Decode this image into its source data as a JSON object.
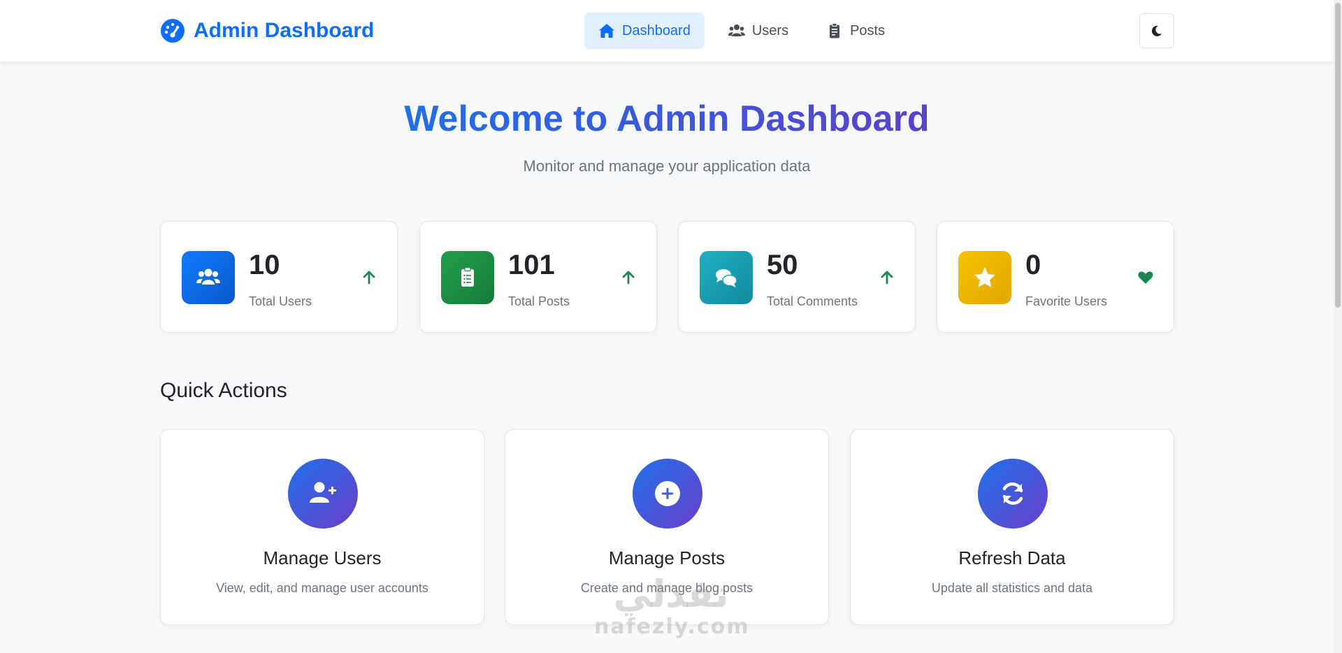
{
  "navbar": {
    "brand": "Admin Dashboard",
    "links": [
      {
        "label": "Dashboard",
        "icon": "home-icon",
        "active": true
      },
      {
        "label": "Users",
        "icon": "users-icon",
        "active": false
      },
      {
        "label": "Posts",
        "icon": "clipboard-icon",
        "active": false
      }
    ],
    "theme_toggle_icon": "moon-icon"
  },
  "hero": {
    "title": "Welcome to Admin Dashboard",
    "subtitle": "Monitor and manage your application data"
  },
  "stats": [
    {
      "value": "10",
      "label": "Total Users",
      "icon": "users-icon",
      "trend_icon": "arrow-up-icon",
      "color": "#0d6efd"
    },
    {
      "value": "101",
      "label": "Total Posts",
      "icon": "clipboard-list-icon",
      "trend_icon": "arrow-up-icon",
      "color": "#198754"
    },
    {
      "value": "50",
      "label": "Total Comments",
      "icon": "comments-icon",
      "trend_icon": "arrow-up-icon",
      "color": "#17a2b8"
    },
    {
      "value": "0",
      "label": "Favorite Users",
      "icon": "star-icon",
      "trend_icon": "heart-icon",
      "color": "#f5b800"
    }
  ],
  "quick_actions": {
    "title": "Quick Actions",
    "items": [
      {
        "title": "Manage Users",
        "description": "View, edit, and manage user accounts",
        "icon": "user-plus-icon"
      },
      {
        "title": "Manage Posts",
        "description": "Create and manage blog posts",
        "icon": "plus-circle-icon"
      },
      {
        "title": "Refresh Data",
        "description": "Update all statistics and data",
        "icon": "refresh-icon"
      }
    ]
  },
  "colors": {
    "primary": "#0d6efd",
    "success": "#198754",
    "info": "#17a2b8",
    "warning": "#f5b800",
    "gradient_start": "#1f6feb",
    "gradient_end": "#6a3fc9"
  },
  "watermark": {
    "arabic": "نفذلي",
    "latin": "nafezly.com"
  }
}
